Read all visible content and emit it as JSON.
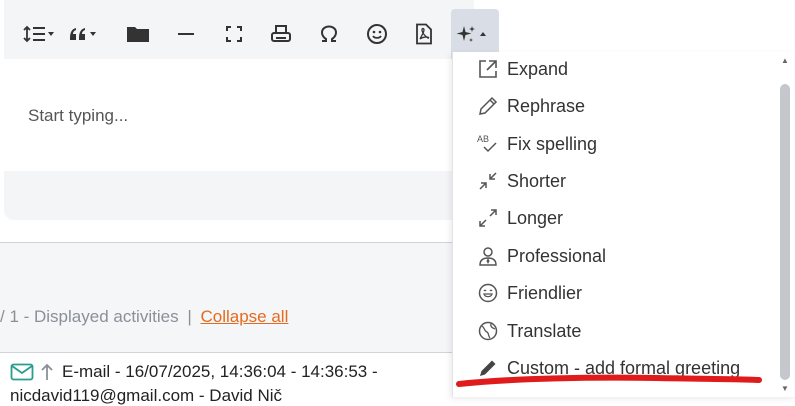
{
  "toolbar": {
    "buttons": [
      {
        "icon": "line-height-icon"
      },
      {
        "icon": "quote-icon"
      },
      {
        "icon": "folder-icon"
      },
      {
        "icon": "horizontal-rule-icon"
      },
      {
        "icon": "fullscreen-icon"
      },
      {
        "icon": "print-icon"
      },
      {
        "icon": "omega-icon"
      },
      {
        "icon": "emoji-icon"
      },
      {
        "icon": "pdf-icon"
      },
      {
        "icon": "ai-sparkle-icon"
      }
    ]
  },
  "editor": {
    "placeholder": "Start typing..."
  },
  "ai_menu": {
    "items": [
      {
        "label": "Expand",
        "icon": "external-link-icon"
      },
      {
        "label": "Rephrase",
        "icon": "pencil-icon"
      },
      {
        "label": "Fix spelling",
        "icon": "spellcheck-icon"
      },
      {
        "label": "Shorter",
        "icon": "shrink-icon"
      },
      {
        "label": "Longer",
        "icon": "expand-arrows-icon"
      },
      {
        "label": "Professional",
        "icon": "user-tie-icon"
      },
      {
        "label": "Friendlier",
        "icon": "smile-icon"
      },
      {
        "label": "Translate",
        "icon": "globe-icon"
      },
      {
        "label": "Custom - add formal greeting",
        "icon": "pen-icon"
      }
    ]
  },
  "activities": {
    "prefix": "/ 1 - Displayed activities",
    "separator": "|",
    "collapse_label": "Collapse all"
  },
  "email": {
    "line1": "E-mail - 16/07/2025, 14:36:04 - 14:36:53 -",
    "line2": "nicdavid119@gmail.com - David Nič"
  },
  "colors": {
    "accent": "#e36b1f",
    "annotation": "#e01b1b",
    "email_icon": "#2a9d8f"
  }
}
